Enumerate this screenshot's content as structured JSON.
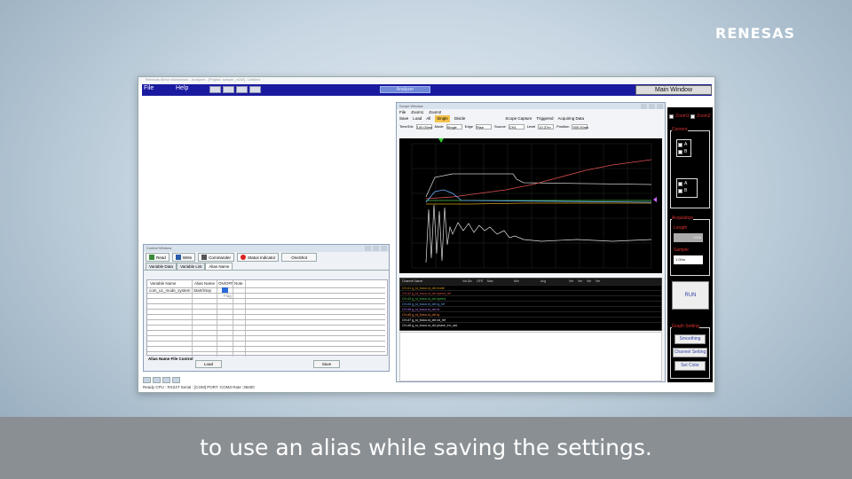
{
  "brand": {
    "logo_text": "RENESAS"
  },
  "app": {
    "title_strip": "Renesas Motor Workbench - Analyzer - [Project: sample_rx24t] - Untitled",
    "menu": {
      "file": "File",
      "help": "Help"
    },
    "analysis_tab": "Analyzer",
    "main_window_button": "Main Window"
  },
  "control_window": {
    "title": "Control Window",
    "toolbar": {
      "read": "Read",
      "write": "Write",
      "commander": "Commander",
      "status_indicator": "Status Indicator",
      "oneshot": "OneShot"
    },
    "tabs": [
      "Variable Data",
      "Variable List",
      "Alias Name"
    ],
    "columns": [
      "Variable Name",
      "Alias Name",
      "ON/OFF",
      "Note"
    ],
    "rows": [
      {
        "variable": "com_u1_mode_system",
        "alias": "Start/Stop",
        "value": "Flag"
      }
    ],
    "alias_file_control": {
      "label": "Alias Name File Control",
      "load": "Load",
      "save": "Save"
    }
  },
  "status_bar": "Ready   CPU : RX24T Serial : [COM]   PORT :COM3   Rate :38400",
  "scope_window": {
    "title": "Scope Window",
    "menu": [
      "File",
      "Zoom1",
      "Zoom2"
    ],
    "tools": [
      "Save",
      "Load",
      "All",
      "Single",
      "Divide",
      "Scope Capture",
      "Triggered",
      "Acquiring Data"
    ],
    "params": [
      "Time/Div",
      "100.00ms",
      "Mode",
      "Single",
      "Edge",
      "Rise",
      "Source",
      "CH1",
      "Level",
      "10.37m",
      "Position",
      "500.00ms"
    ],
    "channel_table": {
      "columns": [
        "Channel Name",
        "Vol.Div",
        "OFS",
        "Max",
        "Min",
        "Avg",
        "Ver",
        "Ver",
        "Ver",
        "Ver"
      ],
      "rows": [
        {
          "name": "CH-#1  g_st_focus.st_ctrl.mode",
          "color": "#d4a017"
        },
        {
          "name": "CH-#2  g_st_focus.st_ctrl.speed_ref",
          "color": "#e05050"
        },
        {
          "name": "CH-#3  g_st_focus.st_ctrl.speed",
          "color": "#50c850"
        },
        {
          "name": "CH-#4  g_st_focus.st_ctrl.iq_ref",
          "color": "#6ab0ff"
        },
        {
          "name": "CH-#5  g_st_focus.st_ctrl.id",
          "color": "#c080ff"
        },
        {
          "name": "CH-#6  g_st_focus.st_ctrl.iq",
          "color": "#ff8c40"
        },
        {
          "name": "CH-#7  g_st_focus.st_ctrl.vd_ref",
          "color": "#ffffff"
        },
        {
          "name": "CH-#8  g_st_focus.st_ctrl.phase_err_rad",
          "color": "#e6e6e6"
        }
      ]
    }
  },
  "right_panel": {
    "zoom1": "Zoom1",
    "zoom2": "Zoom2",
    "cursors": "Cursors",
    "cursor_a": "A",
    "cursor_b": "B",
    "acquisition": "Acquisition",
    "length_label": "Length",
    "length_value": "1000",
    "sample_label": "Sample",
    "sample_value": "1.00m",
    "run": "RUN",
    "graph_setting": "Graph Setting",
    "smoothing": "Smoothing",
    "channel_setting": "Channel Setting",
    "set_color": "Set Color"
  },
  "caption": "to use an alias while saving the settings."
}
